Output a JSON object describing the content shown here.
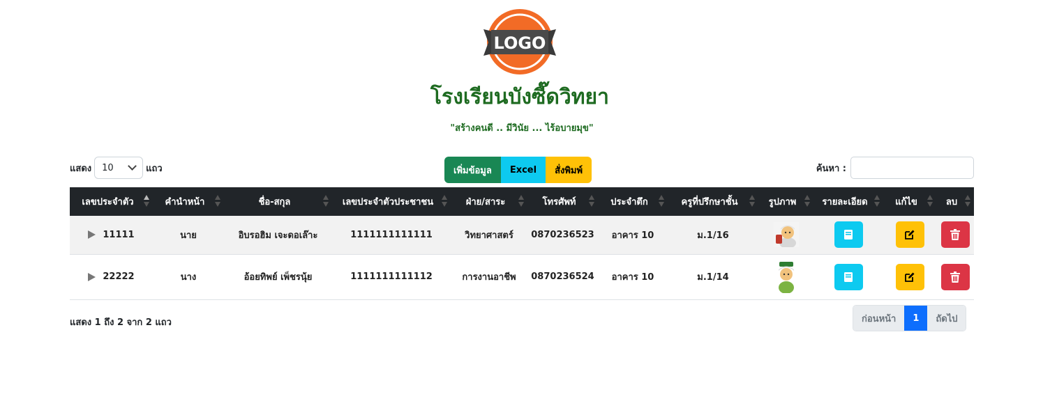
{
  "header": {
    "logo_text": "LOGO",
    "school_name": "โรงเรียนบังซี๊ดวิทยา",
    "slogan": "\"สร้างคนดี .. มีวินัย ... ไร้อบายมุข\""
  },
  "controls": {
    "show_label": "แสดง",
    "page_length": "10",
    "rows_label": "แถว",
    "add_button": "เพิ่มข้อมูล",
    "excel_button": "Excel",
    "print_button": "สั่งพิมพ์",
    "search_label": "ค้นหา :",
    "search_value": ""
  },
  "table": {
    "columns": [
      "เลขประจำตัว",
      "คำนำหน้า",
      "ชื่อ-สกุล",
      "เลขประจำตัวประชาชน",
      "ฝ่าย/สาระ",
      "โทรศัพท์",
      "ประจำตึก",
      "ครูที่ปรึกษาชั้น",
      "รูปภาพ",
      "รายละเอียด",
      "แก้ไข",
      "ลบ"
    ],
    "rows": [
      {
        "id": "11111",
        "prefix": "นาย",
        "name": "อิบรอฮิม เจะดอเล๊าะ",
        "citizen_id": "1111111111111",
        "dept": "วิทยาศาสตร์",
        "phone": "0870236523",
        "building": "อาคาร 10",
        "advisor": "ม.1/16"
      },
      {
        "id": "22222",
        "prefix": "นาง",
        "name": "อ้อยทิพย์ เพ็ชรนุ้ย",
        "citizen_id": "1111111111112",
        "dept": "การงานอาชีพ",
        "phone": "0870236524",
        "building": "อาคาร 10",
        "advisor": "ม.1/14"
      }
    ]
  },
  "footer": {
    "info": "แสดง 1 ถึง 2 จาก 2 แถว",
    "prev": "ก่อนหน้า",
    "current_page": "1",
    "next": "ถัดไป"
  },
  "colors": {
    "title_green": "#1e6b21",
    "header_dark": "#212529",
    "success": "#198754",
    "info": "#0dcaf0",
    "warning": "#ffc107",
    "danger": "#dc3545",
    "primary": "#0d6efd"
  },
  "icons": {
    "detail": "book-icon",
    "edit": "pencil-square-icon",
    "delete": "trash-icon",
    "expand": "caret-right-icon"
  }
}
